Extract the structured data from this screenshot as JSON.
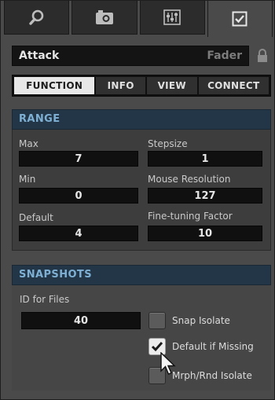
{
  "tabs": [
    {
      "id": "search",
      "icon": "search-icon"
    },
    {
      "id": "snapshot",
      "icon": "camera-icon"
    },
    {
      "id": "mixer",
      "icon": "mixer-icon"
    },
    {
      "id": "properties",
      "icon": "checkbox-icon",
      "active": true
    }
  ],
  "control": {
    "name": "Attack",
    "type": "Fader",
    "lock_icon": "lock-icon"
  },
  "subtabs": [
    {
      "label": "FUNCTION",
      "active": true
    },
    {
      "label": "INFO"
    },
    {
      "label": "VIEW"
    },
    {
      "label": "CONNECT"
    }
  ],
  "range": {
    "title": "RANGE",
    "max_label": "Max",
    "max_value": "7",
    "stepsize_label": "Stepsize",
    "stepsize_value": "1",
    "min_label": "Min",
    "min_value": "0",
    "mouse_res_label": "Mouse Resolution",
    "mouse_res_value": "127",
    "default_label": "Default",
    "default_value": "4",
    "finetune_label": "Fine-tuning Factor",
    "finetune_value": "10"
  },
  "snapshots": {
    "title": "SNAPSHOTS",
    "id_label": "ID for Files",
    "id_value": "40",
    "snap_isolate": {
      "label": "Snap Isolate",
      "checked": false
    },
    "default_if_missing": {
      "label": "Default if Missing",
      "checked": true
    },
    "mrph_isolate": {
      "label": "Mrph/Rnd Isolate",
      "checked": false
    }
  },
  "colors": {
    "accent": "#7eb0d4",
    "header_bg": "#233648",
    "panel_bg": "#4a4a4a"
  }
}
